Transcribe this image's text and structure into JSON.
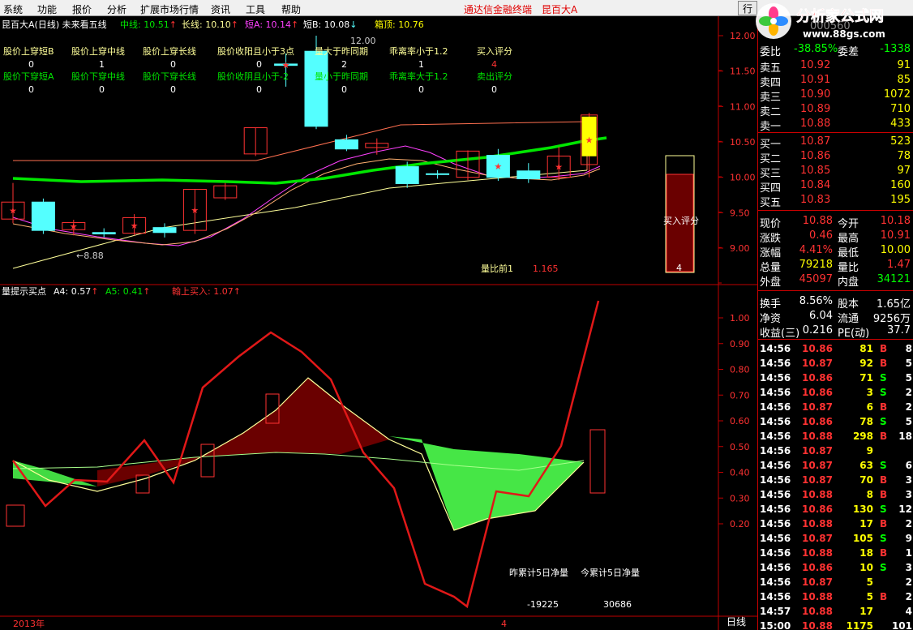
{
  "menu": {
    "items": [
      "系统",
      "功能",
      "报价",
      "分析",
      "扩展市场行情",
      "资讯",
      "工具",
      "帮助"
    ],
    "title": "通达信金融终端",
    "stock": "昆百大A",
    "btn": "行"
  },
  "logo": {
    "text": "分析家公式网",
    "url": "www.88gs.com"
  },
  "chart": {
    "header": {
      "name": "昆百大A",
      "period": "(日线)",
      "formula": "未来看五线",
      "mid_label": "中线:",
      "mid": "10.51",
      "long_label": "长线:",
      "long": "10.10",
      "shortA_label": "短A:",
      "shortA": "10.14",
      "shortB_label": "短B:",
      "shortB": "10.08",
      "box_label": "箱顶:",
      "box": "10.76",
      "lc": "#ffff00"
    },
    "signal_table": {
      "row1": [
        "股价上穿短B",
        "股价上穿中线",
        "股价上穿长线",
        "股价收阳且小于3点",
        "量大于昨同期",
        "乖离率小于1.2",
        "买入评分"
      ],
      "row1v": [
        "0",
        "1",
        "0",
        "0",
        "2",
        "1",
        "4"
      ],
      "row2": [
        "股价下穿短A",
        "股价下穿中线",
        "股价下穿长线",
        "股价收阴且小于-2",
        "量小于昨同期",
        "乖离率大于1.2",
        "卖出评分"
      ],
      "row2v": [
        "0",
        "0",
        "0",
        "0",
        "0",
        "0",
        "0"
      ]
    },
    "price_axis": [
      "12.00",
      "11.50",
      "11.00",
      "10.50",
      "10.00",
      "9.50",
      "9.00"
    ],
    "hi_label": "12.00",
    "lo_label": "8.88",
    "vol_ratio_label": "量比前1",
    "vol_ratio": "1.165",
    "buy_score_label": "买入评分",
    "buy_score": "4",
    "lower": {
      "name": "量提示买点",
      "a4_label": "A4:",
      "a4": "0.57",
      "a5_label": "A5:",
      "a5": "0.41",
      "buy_label": "翰上买入:",
      "buy": "1.07"
    },
    "lower_axis": [
      "1.00",
      "0.90",
      "0.80",
      "0.70",
      "0.60",
      "0.50",
      "0.40",
      "0.30",
      "0.20"
    ],
    "net_labels": [
      "昨累计5日净量",
      "今累计5日净量"
    ],
    "net_values": [
      "-19225",
      "30686"
    ],
    "bottom": {
      "year": "2013年",
      "n": "4",
      "period": "日线"
    },
    "candles": [
      {
        "o": 9.41,
        "c": 9.65,
        "h": 9.92,
        "l": 9.35
      },
      {
        "o": 9.65,
        "c": 9.25,
        "h": 9.7,
        "l": 9.2
      },
      {
        "o": 9.26,
        "c": 9.36,
        "h": 9.4,
        "l": 9.18
      },
      {
        "o": 9.22,
        "c": 9.2,
        "h": 9.28,
        "l": 9.15
      },
      {
        "o": 9.21,
        "c": 9.43,
        "h": 9.48,
        "l": 9.18
      },
      {
        "o": 9.29,
        "c": 9.22,
        "h": 9.35,
        "l": 9.15
      },
      {
        "o": 9.25,
        "c": 9.83,
        "h": 9.83,
        "l": 9.2
      },
      {
        "o": 9.71,
        "c": 9.88,
        "h": 9.92,
        "l": 9.68
      },
      {
        "o": 10.33,
        "c": 10.7,
        "h": 10.7,
        "l": 10.3
      },
      {
        "o": 11.6,
        "c": 11.58,
        "h": 11.75,
        "l": 11.28
      },
      {
        "o": 11.78,
        "c": 10.72,
        "h": 12.0,
        "l": 10.68
      },
      {
        "o": 10.53,
        "c": 10.4,
        "h": 10.6,
        "l": 10.37
      },
      {
        "o": 10.42,
        "c": 10.48,
        "h": 10.55,
        "l": 10.32
      },
      {
        "o": 10.15,
        "c": 9.91,
        "h": 10.22,
        "l": 9.85
      },
      {
        "o": 10.05,
        "c": 10.04,
        "h": 10.1,
        "l": 9.98
      },
      {
        "o": 10.0,
        "c": 10.37,
        "h": 10.38,
        "l": 9.96
      },
      {
        "o": 10.31,
        "c": 10.0,
        "h": 10.4,
        "l": 9.95
      },
      {
        "o": 10.09,
        "c": 9.98,
        "h": 10.2,
        "l": 9.92
      },
      {
        "o": 10.0,
        "c": 10.3,
        "h": 10.43,
        "l": 9.96
      },
      {
        "o": 10.18,
        "c": 10.88,
        "h": 10.91,
        "l": 10.0
      }
    ],
    "lower_candles": [
      {
        "o": 0.18,
        "c": 0.26
      },
      {
        "o": 0.46,
        "c": 0.48
      },
      {
        "o": 0.34,
        "c": 0.4
      },
      {
        "o": 0.4,
        "c": 0.42
      },
      {
        "o": 0.43,
        "c": 0.54
      },
      {
        "o": 0.62,
        "c": 0.73
      },
      {
        "o": 0.32,
        "c": 0.57
      }
    ],
    "colors": {
      "up": "#ff3232",
      "down": "#54ffff",
      "mid": "#00e600",
      "long": "#ffff99",
      "shortA": "#ff40ff",
      "box": "#ff7050",
      "shortB": "#ffb070"
    }
  },
  "quote": {
    "top_ticker": "000560",
    "weibi": {
      "l": "委比",
      "v": "-38.85%",
      "l2": "委差",
      "v2": "-1338"
    },
    "sell": [
      {
        "l": "卖五",
        "p": "10.92",
        "v": "91"
      },
      {
        "l": "卖四",
        "p": "10.91",
        "v": "85"
      },
      {
        "l": "卖三",
        "p": "10.90",
        "v": "1072"
      },
      {
        "l": "卖二",
        "p": "10.89",
        "v": "710"
      },
      {
        "l": "卖一",
        "p": "10.88",
        "v": "433"
      }
    ],
    "buy": [
      {
        "l": "买一",
        "p": "10.87",
        "v": "523"
      },
      {
        "l": "买二",
        "p": "10.86",
        "v": "78"
      },
      {
        "l": "买三",
        "p": "10.85",
        "v": "97"
      },
      {
        "l": "买四",
        "p": "10.84",
        "v": "160"
      },
      {
        "l": "买五",
        "p": "10.83",
        "v": "195"
      }
    ],
    "stats": [
      {
        "l": "现价",
        "v": "10.88",
        "l2": "今开",
        "v2": "10.18",
        "c": "#ff3232",
        "c2": "#ff3232"
      },
      {
        "l": "涨跌",
        "v": "0.46",
        "l2": "最高",
        "v2": "10.91",
        "c": "#ff3232",
        "c2": "#ff3232"
      },
      {
        "l": "涨幅",
        "v": "4.41%",
        "l2": "最低",
        "v2": "10.00",
        "c": "#ff3232",
        "c2": "#ffff00"
      },
      {
        "l": "总量",
        "v": "79218",
        "l2": "量比",
        "v2": "1.47",
        "c": "#ffff00",
        "c2": "#ff3232"
      },
      {
        "l": "外盘",
        "v": "45097",
        "l2": "内盘",
        "v2": "34121",
        "c": "#ff3232",
        "c2": "#00ff00"
      }
    ],
    "stats2": [
      {
        "l": "换手",
        "v": "8.56%",
        "l2": "股本",
        "v2": "1.65亿"
      },
      {
        "l": "净资",
        "v": "6.04",
        "l2": "流通",
        "v2": "9256万"
      },
      {
        "l": "收益(三)",
        "v": "0.216",
        "l2": "PE(动)",
        "v2": "37.7"
      }
    ],
    "ticks": [
      [
        "14:56",
        "10.86",
        "81",
        "B",
        "8"
      ],
      [
        "14:56",
        "10.87",
        "92",
        "B",
        "5"
      ],
      [
        "14:56",
        "10.86",
        "71",
        "S",
        "5"
      ],
      [
        "14:56",
        "10.86",
        "3",
        "S",
        "2"
      ],
      [
        "14:56",
        "10.87",
        "6",
        "B",
        "2"
      ],
      [
        "14:56",
        "10.86",
        "78",
        "S",
        "5"
      ],
      [
        "14:56",
        "10.88",
        "298",
        "B",
        "18"
      ],
      [
        "14:56",
        "10.87",
        "9",
        "",
        ""
      ],
      [
        "14:56",
        "10.87",
        "63",
        "S",
        "6"
      ],
      [
        "14:56",
        "10.87",
        "70",
        "B",
        "3"
      ],
      [
        "14:56",
        "10.88",
        "8",
        "B",
        "3"
      ],
      [
        "14:56",
        "10.86",
        "130",
        "S",
        "12"
      ],
      [
        "14:56",
        "10.88",
        "17",
        "B",
        "2"
      ],
      [
        "14:56",
        "10.87",
        "105",
        "S",
        "9"
      ],
      [
        "14:56",
        "10.88",
        "18",
        "B",
        "1"
      ],
      [
        "14:56",
        "10.86",
        "10",
        "S",
        "3"
      ],
      [
        "14:56",
        "10.87",
        "5",
        "",
        "2"
      ],
      [
        "14:56",
        "10.88",
        "5",
        "B",
        "2"
      ],
      [
        "14:57",
        "10.88",
        "17",
        "",
        "4"
      ],
      [
        "15:00",
        "10.88",
        "1175",
        "",
        "101"
      ]
    ]
  }
}
